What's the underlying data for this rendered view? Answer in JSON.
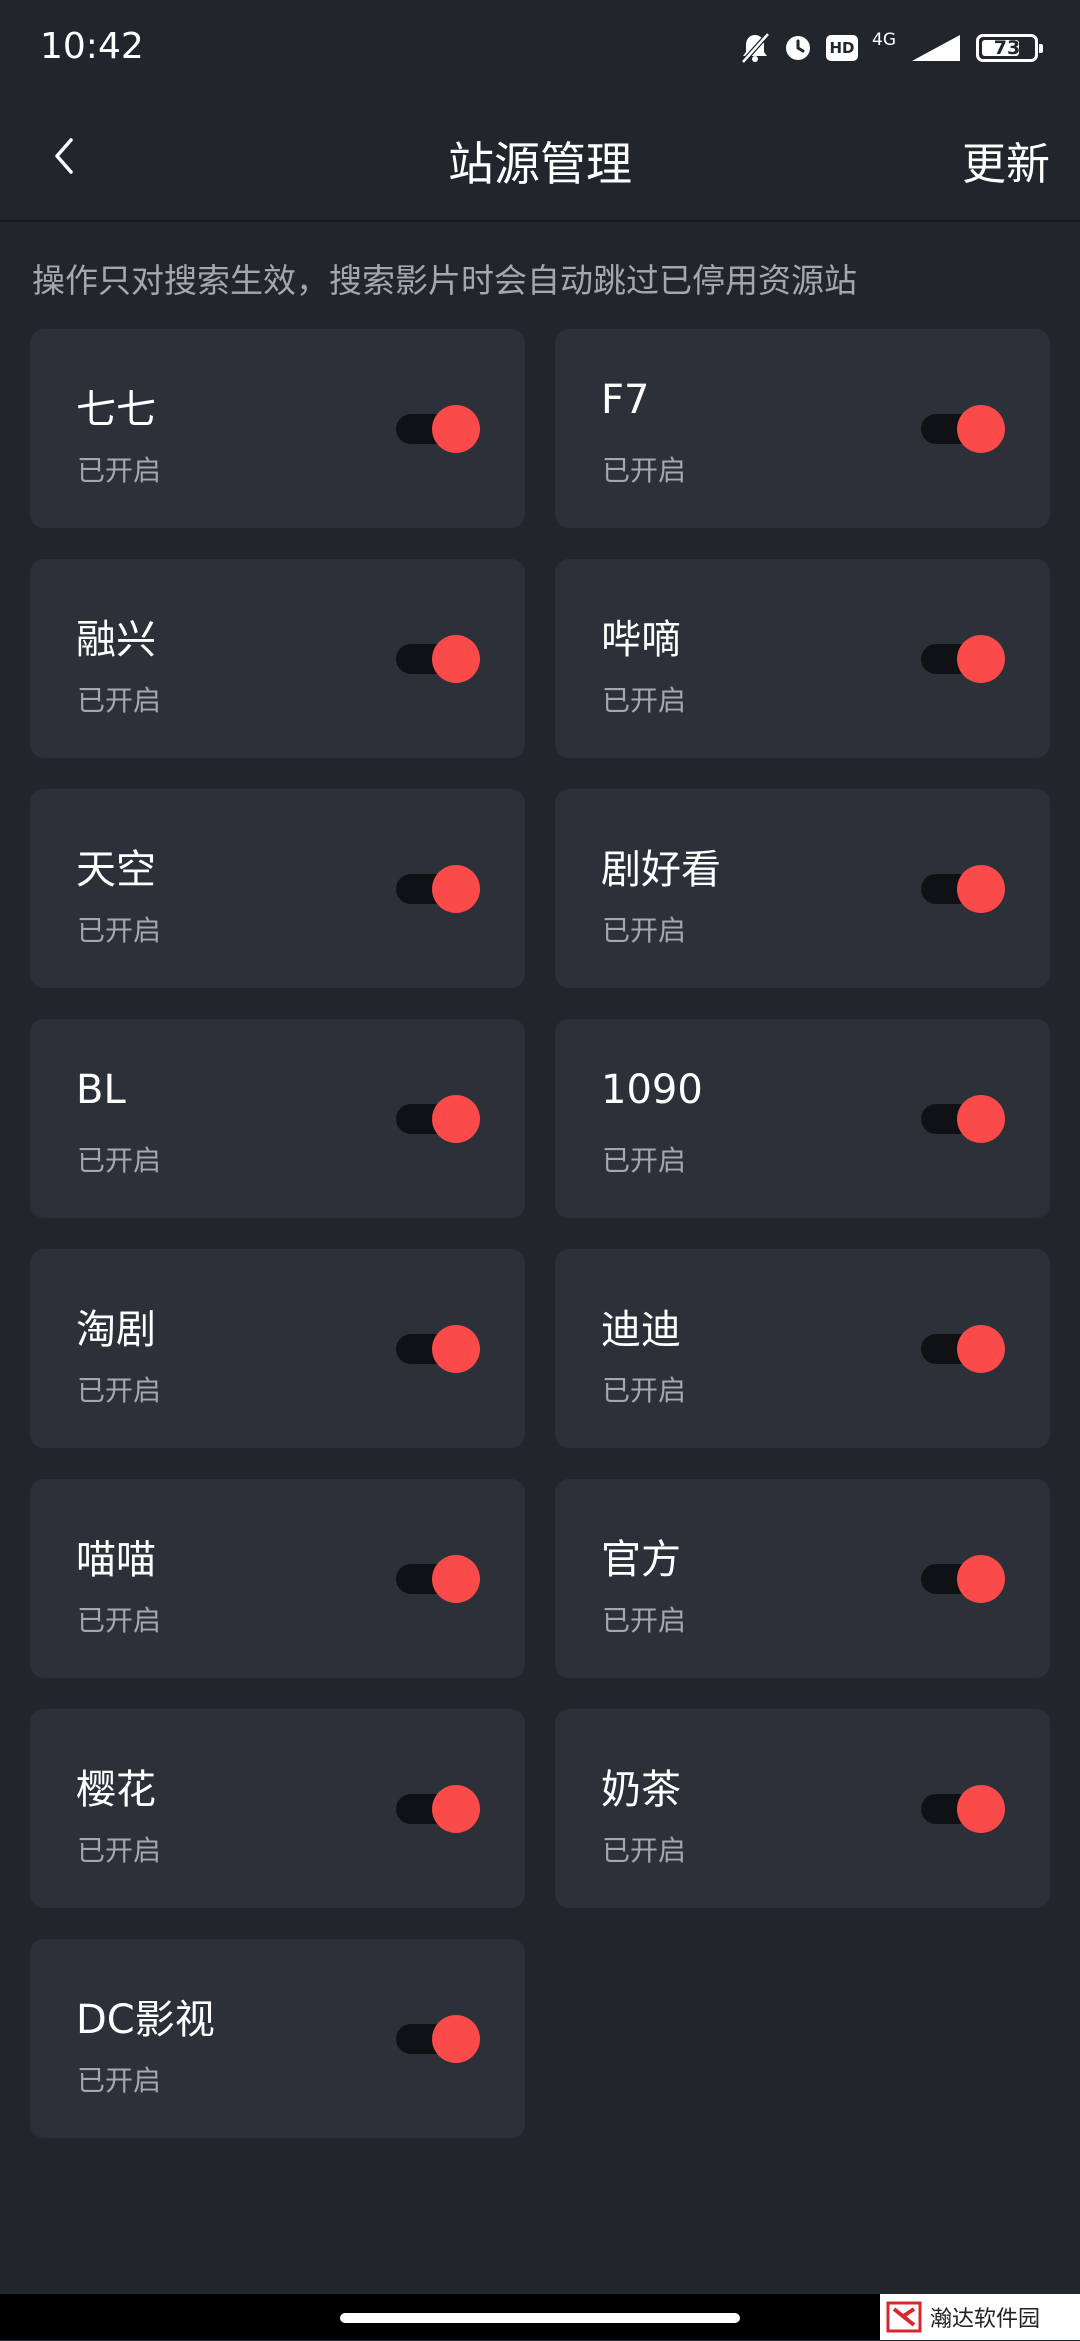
{
  "status_bar": {
    "time": "10:42",
    "network": "4G",
    "hd_label": "HD",
    "battery_percent": 73,
    "battery_label": "73"
  },
  "header": {
    "title": "站源管理",
    "update_label": "更新"
  },
  "notice": "操作只对搜索生效，搜索影片时会自动跳过已停用资源站",
  "colors": {
    "background": "#21252c",
    "card": "#2c3039",
    "accent": "#fb4a4a",
    "secondary_text": "#a4a8ae"
  },
  "sources": [
    {
      "name": "七七",
      "status": "已开启",
      "enabled": true
    },
    {
      "name": "F7",
      "status": "已开启",
      "enabled": true
    },
    {
      "name": "融兴",
      "status": "已开启",
      "enabled": true
    },
    {
      "name": "哔嘀",
      "status": "已开启",
      "enabled": true
    },
    {
      "name": "天空",
      "status": "已开启",
      "enabled": true
    },
    {
      "name": "剧好看",
      "status": "已开启",
      "enabled": true
    },
    {
      "name": "BL",
      "status": "已开启",
      "enabled": true
    },
    {
      "name": "1090",
      "status": "已开启",
      "enabled": true
    },
    {
      "name": "淘剧",
      "status": "已开启",
      "enabled": true
    },
    {
      "name": "迪迪",
      "status": "已开启",
      "enabled": true
    },
    {
      "name": "喵喵",
      "status": "已开启",
      "enabled": true
    },
    {
      "name": "官方",
      "status": "已开启",
      "enabled": true
    },
    {
      "name": "樱花",
      "status": "已开启",
      "enabled": true
    },
    {
      "name": "奶茶",
      "status": "已开启",
      "enabled": true
    },
    {
      "name": "DC影视",
      "status": "已开启",
      "enabled": true
    }
  ],
  "watermark": "瀚达软件园"
}
